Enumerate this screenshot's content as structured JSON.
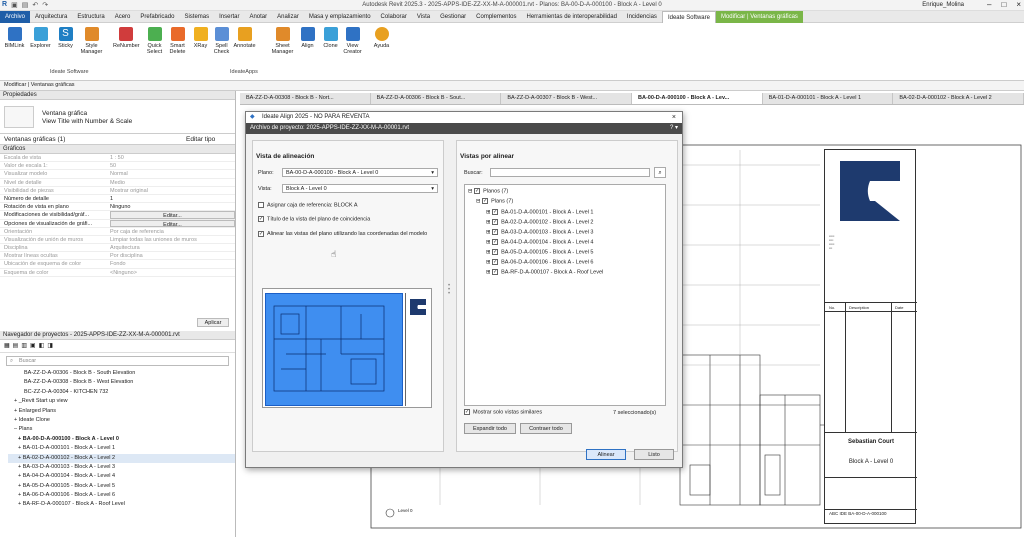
{
  "titlebar": {
    "title": "Autodesk Revit 2025.3 - 2025-APPS-IDE-ZZ-XX-M-A-000001.rvt - Planos: BA-00-D-A-000100 - Block A - Level 0",
    "user": "Enrique_Molina"
  },
  "ribbon_tabs": [
    "Archivo",
    "Arquitectura",
    "Estructura",
    "Acero",
    "Prefabricado",
    "Sistemas",
    "Insertar",
    "Anotar",
    "Analizar",
    "Masa y emplazamiento",
    "Colaborar",
    "Vista",
    "Gestionar",
    "Complementos",
    "Herramientas de interoperabilidad",
    "Incidencias",
    "Ideate Software",
    "Modificar | Ventanas gráficas"
  ],
  "ribbon_buttons": [
    "BIMLink",
    "Explorer",
    "Sticky",
    "Style Manager",
    "ReNumber",
    "Quick Select",
    "Smart Delete",
    "XRay",
    "Spell Check",
    "Annotate",
    "Sheet Manager",
    "Align",
    "Clone",
    "View Creator",
    "Ayuda"
  ],
  "ribbon_panels": {
    "left": "Ideate Software",
    "right": "IdeateApps"
  },
  "context_bar": "Modificar | Ventanas gráficas",
  "properties": {
    "header": "Propiedades",
    "type_name": "Ventana gráfica",
    "type_sub": "View Title with Number & Scale",
    "selector": "Ventanas gráficas (1)",
    "edit_type": "Editar tipo",
    "section": "Gráficos",
    "rows": [
      {
        "k": "Escala de vista",
        "v": "1 : 50"
      },
      {
        "k": "Valor de escala    1:",
        "v": "50"
      },
      {
        "k": "Visualizar modelo",
        "v": "Normal"
      },
      {
        "k": "Nivel de detalle",
        "v": "Medio"
      },
      {
        "k": "Visibilidad de piezas",
        "v": "Mostrar original"
      },
      {
        "k": "Número de detalle",
        "v": "1"
      },
      {
        "k": "Rotación de vista en plano",
        "v": "Ninguno"
      },
      {
        "k": "Modificaciones de visibilidad/gráf...",
        "v": "Editar..."
      },
      {
        "k": "Opciones de visualización de gráfi...",
        "v": "Editar..."
      },
      {
        "k": "Orientación",
        "v": "Por caja de referencia"
      },
      {
        "k": "Visualización de unión de muros",
        "v": "Limpiar todas las uniones de muros"
      },
      {
        "k": "Disciplina",
        "v": "Arquitectura"
      },
      {
        "k": "Mostrar líneas ocultas",
        "v": "Por disciplina"
      },
      {
        "k": "Ubicación de esquema de color",
        "v": "Fondo"
      },
      {
        "k": "Esquema de color",
        "v": "<Ninguno>"
      }
    ],
    "apply": "Aplicar"
  },
  "browser": {
    "header": "Navegador de proyectos - 2025-APPS-IDE-ZZ-XX-M-A-000001.rvt",
    "search_placeholder": "Buscar",
    "items": [
      "BA-ZZ-D-A-00306 - Block B - South Elevation",
      "BA-ZZ-D-A-00308 - Block B - West Elevation",
      "BC-ZZ-D-A-00304 - KITCHEN 732",
      "_Revit Start up view",
      "Enlarged Plans",
      "Ideate Clone",
      "Plans",
      "BA-00-D-A-000100 - Block A - Level 0",
      "BA-01-D-A-000101 - Block A - Level 1",
      "BA-02-D-A-000102 - Block A - Level 2",
      "BA-03-D-A-000103 - Block A - Level 3",
      "BA-04-D-A-000104 - Block A - Level 4",
      "BA-05-D-A-000105 - Block A - Level 5",
      "BA-06-D-A-000106 - Block A - Level 6",
      "BA-RF-D-A-000107 - Block A - Roof Level"
    ]
  },
  "doc_tabs": [
    "BA-ZZ-D-A-00308 - Block B - Nort...",
    "BA-ZZ-D-A-00306 - Block B - Sout...",
    "BA-ZZ-D-A-00307 - Block B - West...",
    "BA-00-D-A-000100 - Block A - Lev...",
    "BA-01-D-A-000101 - Block A - Level 1",
    "BA-02-D-A-000102 - Block A - Level 2"
  ],
  "dialog": {
    "title": "Ideate Align 2025 - NO PARA REVENTA",
    "subtitle": "Archivo de proyecto: 2025-APPS-IDE-ZZ-XX-M-A-00001.rvt",
    "left_group": "Vista de alineación",
    "plano_label": "Plano:",
    "plano_value": "BA-00-D-A-000100 - Block A - Level 0",
    "vista_label": "Vista:",
    "vista_value": "Block A - Level 0",
    "opt1": "Asignar caja de referencia:  BLOCK A",
    "opt2": "Título de la vista del plano de coincidencia",
    "opt3": "Alinear las vistas del plano utilizando las coordenadas del modelo",
    "right_group": "Vistas por alinear",
    "search_label": "Buscar:",
    "tree_root": "Planos (7)",
    "tree_plans": "Plans (7)",
    "tree_items": [
      "BA-01-D-A-000101 - Block A - Level 1",
      "BA-02-D-A-000102 - Block A - Level 2",
      "BA-03-D-A-000103 - Block A - Level 3",
      "BA-04-D-A-000104 - Block A - Level 4",
      "BA-05-D-A-000105 - Block A - Level 5",
      "BA-06-D-A-000106 - Block A - Level 6",
      "BA-RF-D-A-000107 - Block A - Roof Level"
    ],
    "similar_only": "Mostrar solo vistas similares",
    "selected_count": "7 seleccionado(s)",
    "expand": "Expandir todo",
    "collapse": "Contraer todo",
    "align": "Alinear",
    "ready": "Listo"
  },
  "titleblock": {
    "project": "Sebastian Court",
    "sheet": "Block A - Level 0",
    "number": "ABC IDE BA-00-D-A-000100",
    "col_no": "No.",
    "col_desc": "Description",
    "col_date": "Date",
    "view_label": "Level 0"
  },
  "colors": {
    "file_tab": "#1f5ea8",
    "context_tab": "#7ab648",
    "selection_blue": "#3f8ef0",
    "dialog_header": "#4a4a4a"
  }
}
